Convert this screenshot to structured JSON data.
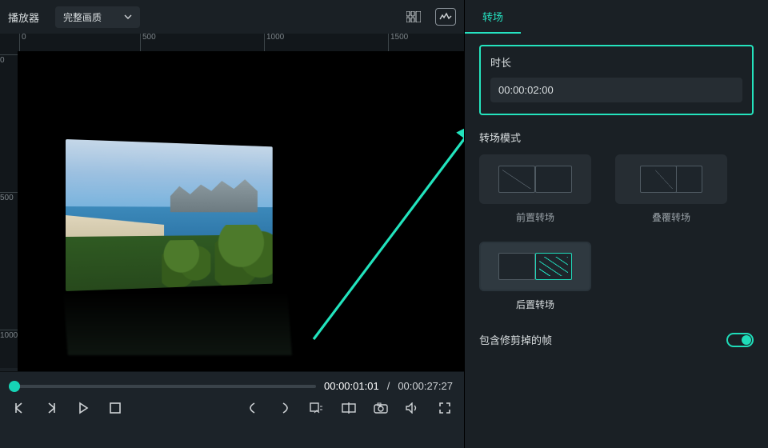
{
  "left": {
    "player_label": "播放器",
    "quality_label": "完整画质",
    "ruler_h": [
      "0",
      "500",
      "1000",
      "1500"
    ],
    "ruler_v": [
      "0",
      "500",
      "1000"
    ],
    "current_time": "00:00:01:01",
    "separator": "/",
    "total_time": "00:00:27:27"
  },
  "right": {
    "tab_label": "转场",
    "duration_label": "时长",
    "duration_value": "00:00:02:00",
    "mode_label": "转场模式",
    "mode_pre": "前置转场",
    "mode_overlap": "叠覆转场",
    "mode_post": "后置转场",
    "include_trimmed": "包含修剪掉的帧"
  }
}
